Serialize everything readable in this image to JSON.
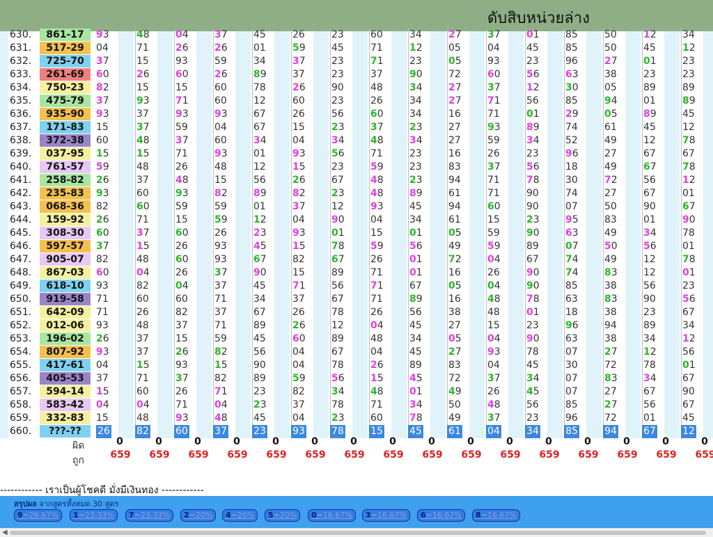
{
  "header_title": "ดับสิบหน่วยล่าง",
  "rows": [
    {
      "n": "630.",
      "r": "861-17",
      "c": "#a8e6a0",
      "v": [
        "93",
        "48",
        "04",
        "37",
        "45",
        "26",
        "23",
        "60",
        "34",
        "27",
        "37",
        "01",
        "85",
        "50",
        "12",
        "34"
      ],
      "h": [
        4,
        9,
        11,
        14,
        -2,
        -2,
        -2,
        -2,
        -2,
        4,
        9,
        11,
        -2,
        -2,
        14,
        -2
      ]
    },
    {
      "n": "631.",
      "r": "517-29",
      "c": "#f4c04f",
      "v": [
        "04",
        "71",
        "26",
        "26",
        "01",
        "59",
        "45",
        "71",
        "12",
        "05",
        "04",
        "45",
        "85",
        "50",
        "45",
        "12"
      ],
      "h": [
        -2,
        -2,
        2,
        2,
        -2,
        9,
        -2,
        -2,
        9,
        -2,
        -2,
        -2,
        -2,
        -2,
        -2,
        9
      ]
    },
    {
      "n": "632.",
      "r": "725-70",
      "c": "#7fd1f0",
      "v": [
        "37",
        "15",
        "93",
        "59",
        "34",
        "37",
        "23",
        "71",
        "23",
        "05",
        "93",
        "23",
        "96",
        "27",
        "01",
        "23"
      ],
      "h": [
        4,
        -2,
        -2,
        -2,
        -2,
        4,
        -2,
        9,
        -2,
        9,
        -2,
        -2,
        -2,
        4,
        9,
        -2
      ]
    },
    {
      "n": "633.",
      "r": "261-69",
      "c": "#f07f7f",
      "v": [
        "60",
        "26",
        "60",
        "26",
        "89",
        "37",
        "23",
        "37",
        "90",
        "72",
        "60",
        "56",
        "63",
        "38",
        "23",
        "23"
      ],
      "h": [
        2,
        2,
        2,
        2,
        9,
        -2,
        -2,
        -2,
        9,
        -2,
        2,
        2,
        2,
        -2,
        -2,
        -2
      ]
    },
    {
      "n": "634.",
      "r": "750-23",
      "c": "#f4f0a0",
      "v": [
        "82",
        "15",
        "15",
        "60",
        "78",
        "26",
        "90",
        "48",
        "34",
        "27",
        "37",
        "12",
        "30",
        "05",
        "89",
        "89"
      ],
      "h": [
        2,
        -2,
        -2,
        -2,
        -2,
        2,
        -2,
        -2,
        9,
        4,
        9,
        2,
        9,
        -2,
        -2,
        -2
      ]
    },
    {
      "n": "635.",
      "r": "475-79",
      "c": "#a8e6a0",
      "v": [
        "37",
        "93",
        "71",
        "60",
        "12",
        "60",
        "23",
        "26",
        "34",
        "27",
        "71",
        "56",
        "85",
        "94",
        "01",
        "89"
      ],
      "h": [
        4,
        9,
        2,
        -2,
        -2,
        -2,
        -2,
        -2,
        -2,
        4,
        2,
        -2,
        -2,
        9,
        -2,
        9
      ]
    },
    {
      "n": "636.",
      "r": "935-90",
      "c": "#f4c04f",
      "v": [
        "93",
        "37",
        "93",
        "93",
        "67",
        "26",
        "56",
        "60",
        "34",
        "16",
        "71",
        "01",
        "29",
        "05",
        "89",
        "45"
      ],
      "h": [
        2,
        -2,
        2,
        2,
        -2,
        -2,
        -2,
        9,
        -2,
        -2,
        -2,
        9,
        2,
        9,
        2,
        -2
      ]
    },
    {
      "n": "637.",
      "r": "171-83",
      "c": "#7fd1f0",
      "v": [
        "15",
        "37",
        "59",
        "04",
        "67",
        "15",
        "23",
        "37",
        "23",
        "27",
        "93",
        "89",
        "74",
        "61",
        "45",
        "12"
      ],
      "h": [
        -2,
        9,
        -2,
        -2,
        -2,
        -2,
        9,
        9,
        9,
        -2,
        9,
        2,
        -2,
        -2,
        -2,
        -2
      ]
    },
    {
      "n": "638.",
      "r": "372-38",
      "c": "#9a84c8",
      "v": [
        "60",
        "48",
        "37",
        "60",
        "34",
        "04",
        "34",
        "48",
        "34",
        "27",
        "59",
        "34",
        "52",
        "49",
        "12",
        "78"
      ],
      "h": [
        -2,
        9,
        2,
        -2,
        2,
        -2,
        2,
        9,
        2,
        -2,
        -2,
        2,
        -2,
        -2,
        -2,
        9
      ]
    },
    {
      "n": "639.",
      "r": "037-95",
      "c": "#f4f0a0",
      "v": [
        "15",
        "15",
        "71",
        "93",
        "01",
        "93",
        "56",
        "71",
        "23",
        "16",
        "26",
        "23",
        "96",
        "27",
        "67",
        "67"
      ],
      "h": [
        9,
        9,
        -2,
        2,
        -2,
        2,
        9,
        -2,
        -2,
        -2,
        -2,
        -2,
        2,
        -2,
        -2,
        -2
      ]
    },
    {
      "n": "640.",
      "r": "761-57",
      "c": "#e8c8f4",
      "v": [
        "59",
        "48",
        "26",
        "48",
        "12",
        "15",
        "23",
        "59",
        "23",
        "83",
        "37",
        "56",
        "18",
        "49",
        "67",
        "78"
      ],
      "h": [
        2,
        -2,
        -2,
        -2,
        -2,
        2,
        -2,
        2,
        -2,
        -2,
        9,
        2,
        -2,
        -2,
        9,
        9
      ]
    },
    {
      "n": "641.",
      "r": "258-82",
      "c": "#a8e6a0",
      "v": [
        "26",
        "37",
        "48",
        "15",
        "56",
        "26",
        "67",
        "48",
        "23",
        "94",
        "71",
        "78",
        "30",
        "72",
        "56",
        "12"
      ],
      "h": [
        9,
        -2,
        2,
        -2,
        -2,
        9,
        -2,
        2,
        9,
        -2,
        -2,
        2,
        -2,
        2,
        -2,
        2
      ]
    },
    {
      "n": "642.",
      "r": "235-83",
      "c": "#f4c04f",
      "v": [
        "93",
        "60",
        "93",
        "82",
        "89",
        "82",
        "23",
        "48",
        "89",
        "61",
        "71",
        "90",
        "74",
        "27",
        "67",
        "01"
      ],
      "h": [
        9,
        -2,
        9,
        2,
        2,
        2,
        9,
        2,
        2,
        -2,
        -2,
        -2,
        -2,
        -2,
        -2,
        -2
      ]
    },
    {
      "n": "643.",
      "r": "068-36",
      "c": "#f4c04f",
      "v": [
        "82",
        "60",
        "59",
        "59",
        "01",
        "37",
        "12",
        "93",
        "45",
        "94",
        "60",
        "90",
        "07",
        "50",
        "90",
        "67"
      ],
      "h": [
        -2,
        9,
        -2,
        -2,
        -2,
        2,
        -2,
        2,
        -2,
        -2,
        9,
        -2,
        -2,
        -2,
        -2,
        9
      ]
    },
    {
      "n": "644.",
      "r": "159-92",
      "c": "#f4f0a0",
      "v": [
        "26",
        "71",
        "15",
        "59",
        "12",
        "04",
        "90",
        "04",
        "34",
        "61",
        "15",
        "23",
        "95",
        "83",
        "01",
        "90"
      ],
      "h": [
        9,
        -2,
        -2,
        9,
        9,
        -2,
        2,
        -2,
        -2,
        -2,
        -2,
        9,
        2,
        -2,
        -2,
        2
      ]
    },
    {
      "n": "645.",
      "r": "308-30",
      "c": "#e8c8f4",
      "v": [
        "60",
        "37",
        "60",
        "26",
        "23",
        "93",
        "01",
        "15",
        "01",
        "05",
        "59",
        "90",
        "63",
        "49",
        "34",
        "78"
      ],
      "h": [
        9,
        2,
        9,
        -2,
        2,
        2,
        9,
        -2,
        9,
        9,
        -2,
        9,
        2,
        -2,
        2,
        -2
      ]
    },
    {
      "n": "646.",
      "r": "597-57",
      "c": "#f4c04f",
      "v": [
        "37",
        "15",
        "26",
        "93",
        "45",
        "15",
        "78",
        "59",
        "56",
        "49",
        "59",
        "89",
        "07",
        "50",
        "56",
        "01"
      ],
      "h": [
        9,
        2,
        -2,
        -2,
        2,
        2,
        9,
        2,
        2,
        -2,
        2,
        -2,
        9,
        2,
        2,
        -2
      ]
    },
    {
      "n": "647.",
      "r": "905-07",
      "c": "#e8c8f4",
      "v": [
        "82",
        "48",
        "60",
        "93",
        "67",
        "82",
        "67",
        "26",
        "01",
        "72",
        "04",
        "67",
        "74",
        "49",
        "12",
        "78"
      ],
      "h": [
        -2,
        -2,
        9,
        -2,
        9,
        -2,
        9,
        -2,
        2,
        9,
        2,
        -2,
        9,
        -2,
        -2,
        9
      ]
    },
    {
      "n": "648.",
      "r": "867-03",
      "c": "#f4f0a0",
      "v": [
        "60",
        "04",
        "26",
        "37",
        "90",
        "15",
        "89",
        "71",
        "01",
        "16",
        "26",
        "90",
        "74",
        "83",
        "12",
        "01"
      ],
      "h": [
        2,
        2,
        -2,
        9,
        2,
        -2,
        -2,
        -2,
        2,
        -2,
        -2,
        2,
        9,
        9,
        -2,
        2
      ]
    },
    {
      "n": "649.",
      "r": "618-10",
      "c": "#7fd1f0",
      "v": [
        "93",
        "82",
        "04",
        "37",
        "45",
        "71",
        "56",
        "71",
        "67",
        "05",
        "04",
        "90",
        "85",
        "38",
        "56",
        "23"
      ],
      "h": [
        -2,
        -2,
        9,
        -2,
        -2,
        2,
        -2,
        2,
        -2,
        9,
        9,
        9,
        -2,
        -2,
        -2,
        -2
      ]
    },
    {
      "n": "650.",
      "r": "919-58",
      "c": "#9a84c8",
      "v": [
        "71",
        "60",
        "60",
        "71",
        "34",
        "37",
        "67",
        "71",
        "89",
        "16",
        "48",
        "78",
        "63",
        "83",
        "90",
        "56"
      ],
      "h": [
        -2,
        -2,
        -2,
        -2,
        -2,
        -2,
        -2,
        -2,
        9,
        -2,
        9,
        2,
        -2,
        9,
        -2,
        2
      ]
    },
    {
      "n": "651.",
      "r": "642-09",
      "c": "#f4f0a0",
      "v": [
        "71",
        "26",
        "82",
        "37",
        "67",
        "26",
        "78",
        "26",
        "56",
        "38",
        "48",
        "01",
        "18",
        "38",
        "23",
        "67"
      ],
      "h": [
        -2,
        -2,
        -2,
        -2,
        -2,
        -2,
        -2,
        -2,
        -2,
        -2,
        -2,
        2,
        -2,
        -2,
        -2,
        -2
      ]
    },
    {
      "n": "652.",
      "r": "012-06",
      "c": "#f4f0a0",
      "v": [
        "93",
        "48",
        "37",
        "71",
        "89",
        "26",
        "12",
        "04",
        "45",
        "27",
        "15",
        "23",
        "96",
        "94",
        "89",
        "34"
      ],
      "h": [
        -2,
        -2,
        -2,
        -2,
        -2,
        9,
        -2,
        2,
        -2,
        -2,
        -2,
        -2,
        9,
        -2,
        -2,
        -2
      ]
    },
    {
      "n": "653.",
      "r": "196-02",
      "c": "#a8e6a0",
      "v": [
        "26",
        "37",
        "15",
        "59",
        "45",
        "60",
        "89",
        "48",
        "34",
        "05",
        "04",
        "90",
        "63",
        "38",
        "34",
        "12"
      ],
      "h": [
        9,
        -2,
        -2,
        -2,
        -2,
        2,
        -2,
        -2,
        -2,
        2,
        2,
        2,
        -2,
        -2,
        -2,
        2
      ]
    },
    {
      "n": "654.",
      "r": "807-92",
      "c": "#f4c04f",
      "v": [
        "93",
        "37",
        "26",
        "82",
        "56",
        "04",
        "67",
        "04",
        "45",
        "27",
        "93",
        "78",
        "07",
        "27",
        "12",
        "56"
      ],
      "h": [
        2,
        -2,
        9,
        9,
        -2,
        -2,
        -2,
        -2,
        -2,
        9,
        2,
        -2,
        -2,
        9,
        9,
        -2
      ]
    },
    {
      "n": "655.",
      "r": "417-61",
      "c": "#7fd1f0",
      "v": [
        "04",
        "15",
        "93",
        "15",
        "90",
        "04",
        "78",
        "26",
        "89",
        "83",
        "04",
        "45",
        "30",
        "72",
        "78",
        "01"
      ],
      "h": [
        -2,
        9,
        -2,
        9,
        -2,
        -2,
        -2,
        2,
        -2,
        -2,
        -2,
        -2,
        -2,
        -2,
        -2,
        9
      ]
    },
    {
      "n": "656.",
      "r": "405-53",
      "c": "#9a84c8",
      "v": [
        "37",
        "71",
        "37",
        "82",
        "89",
        "59",
        "56",
        "15",
        "45",
        "72",
        "37",
        "34",
        "07",
        "83",
        "34",
        "67"
      ],
      "h": [
        -2,
        -2,
        9,
        -2,
        -2,
        9,
        2,
        2,
        2,
        -2,
        9,
        9,
        -2,
        9,
        2,
        -2
      ]
    },
    {
      "n": "657.",
      "r": "594-14",
      "c": "#f4f0a0",
      "v": [
        "15",
        "60",
        "26",
        "71",
        "23",
        "82",
        "34",
        "48",
        "01",
        "49",
        "26",
        "45",
        "07",
        "27",
        "67",
        "90"
      ],
      "h": [
        2,
        -2,
        -2,
        2,
        -2,
        -2,
        9,
        9,
        2,
        9,
        -2,
        9,
        -2,
        -2,
        -2,
        -2
      ]
    },
    {
      "n": "658.",
      "r": "583-42",
      "c": "#e8c8f4",
      "v": [
        "04",
        "04",
        "71",
        "04",
        "23",
        "37",
        "78",
        "71",
        "34",
        "50",
        "48",
        "56",
        "85",
        "27",
        "56",
        "67"
      ],
      "h": [
        2,
        2,
        -2,
        2,
        9,
        -2,
        -2,
        -2,
        2,
        -2,
        2,
        -2,
        -2,
        9,
        -2,
        -2
      ]
    },
    {
      "n": "659.",
      "r": "332-83",
      "c": "#f4f0a0",
      "v": [
        "15",
        "48",
        "93",
        "48",
        "45",
        "04",
        "23",
        "60",
        "78",
        "49",
        "37",
        "23",
        "96",
        "72",
        "01",
        "45"
      ],
      "h": [
        -2,
        -2,
        2,
        2,
        -2,
        -2,
        9,
        -2,
        2,
        -2,
        9,
        -2,
        -2,
        -2,
        -2,
        -2
      ]
    }
  ],
  "last_row": {
    "n": "660.",
    "r": "???-??",
    "v": [
      "26",
      "82",
      "60",
      "37",
      "23",
      "93",
      "78",
      "15",
      "45",
      "61",
      "04",
      "34",
      "85",
      "94",
      "67",
      "12"
    ]
  },
  "labels": {
    "wrong": "ผิด",
    "right": "ถูก"
  },
  "wrong_counts": [
    "0",
    "0",
    "0",
    "0",
    "0",
    "0",
    "0",
    "0",
    "0",
    "0",
    "0",
    "0",
    "0",
    "0",
    "0",
    "0"
  ],
  "right_counts": [
    "659",
    "659",
    "659",
    "659",
    "659",
    "659",
    "659",
    "659",
    "659",
    "659",
    "659",
    "659",
    "659",
    "659",
    "659",
    "659"
  ],
  "footer_line": "------------ เราเป็นผู้โชคดี มั่งมีเงินทอง ------------",
  "summary": {
    "label_bold": "สรุปผล",
    "label_rest": " จากสูตรทั้งหมด 30 สูตร",
    "badges": [
      {
        "d": "9",
        "p": "26.67%"
      },
      {
        "d": "1",
        "p": "23.33%"
      },
      {
        "d": "7",
        "p": "23.33%"
      },
      {
        "d": "2",
        "p": "20%"
      },
      {
        "d": "4",
        "p": "20%"
      },
      {
        "d": "5",
        "p": "20%"
      },
      {
        "d": "0",
        "p": "16.67%"
      },
      {
        "d": "3",
        "p": "16.67%"
      },
      {
        "d": "6",
        "p": "16.67%"
      },
      {
        "d": "8",
        "p": "16.67%"
      }
    ]
  },
  "colors": {
    "header": "#8fae86",
    "band": "#e0f3fb",
    "highlight_pink": "#e040e0",
    "highlight_green": "#2bb52b",
    "last_row_cell": "#3b88e0",
    "summary_bar": "#3ea0ee"
  }
}
